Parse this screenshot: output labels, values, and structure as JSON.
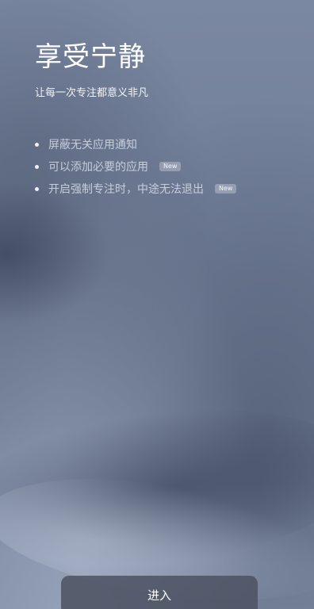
{
  "header": {
    "title": "享受宁静",
    "subtitle": "让每一次专注都意义非凡"
  },
  "features": [
    {
      "text": "屏蔽无关应用通知",
      "badge": ""
    },
    {
      "text": "可以添加必要的应用",
      "badge": "New"
    },
    {
      "text": "开启强制专注时，中途无法退出",
      "badge": "New"
    }
  ],
  "action": {
    "enter_label": "进入"
  }
}
